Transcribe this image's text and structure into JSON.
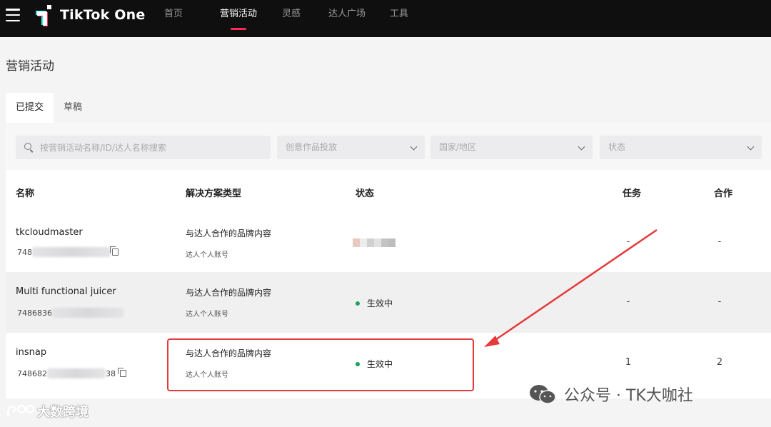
{
  "app": {
    "brand": "TikTok One"
  },
  "nav": {
    "items": [
      {
        "label": "首页",
        "active": false
      },
      {
        "label": "营销活动",
        "active": true
      },
      {
        "label": "灵感",
        "active": false
      },
      {
        "label": "达人广场",
        "active": false
      },
      {
        "label": "工具",
        "active": false
      }
    ]
  },
  "page": {
    "title": "营销活动"
  },
  "tabs": [
    {
      "label": "已提交",
      "active": true
    },
    {
      "label": "草稿",
      "active": false
    }
  ],
  "filters": {
    "search_placeholder": "按营销活动名称/ID/达人名称搜索",
    "select1": "创意作品投放",
    "select2": "国家/地区",
    "select3": "状态"
  },
  "table": {
    "headers": {
      "name": "名称",
      "solution": "解决方案类型",
      "status": "状态",
      "tasks": "任务",
      "coop": "合作"
    },
    "rows": [
      {
        "name": "tkcloudmaster",
        "id_prefix": "748",
        "solution": "与达人合作的品牌内容",
        "sub": "达人个人账号",
        "status": "",
        "tasks": "-",
        "coop": "-"
      },
      {
        "name": "Multi functional juicer",
        "id_prefix": "7486836",
        "solution": "与达人合作的品牌内容",
        "sub": "达人个人账号",
        "status": "生效中",
        "tasks": "-",
        "coop": "-"
      },
      {
        "name": "insnap",
        "id_prefix": "748682",
        "id_suffix": "38",
        "solution": "与达人合作的品牌内容",
        "sub": "达人个人账号",
        "status": "生效中",
        "tasks": "1",
        "coop": "2"
      }
    ]
  },
  "watermark": {
    "wechat": "公众号 · TK大咖社",
    "corner": "大数跨境"
  },
  "colors": {
    "accent": "#fe2c55",
    "brand_cyan": "#25f4ee",
    "status_active": "#1aa260",
    "highlight": "#e5393a"
  }
}
